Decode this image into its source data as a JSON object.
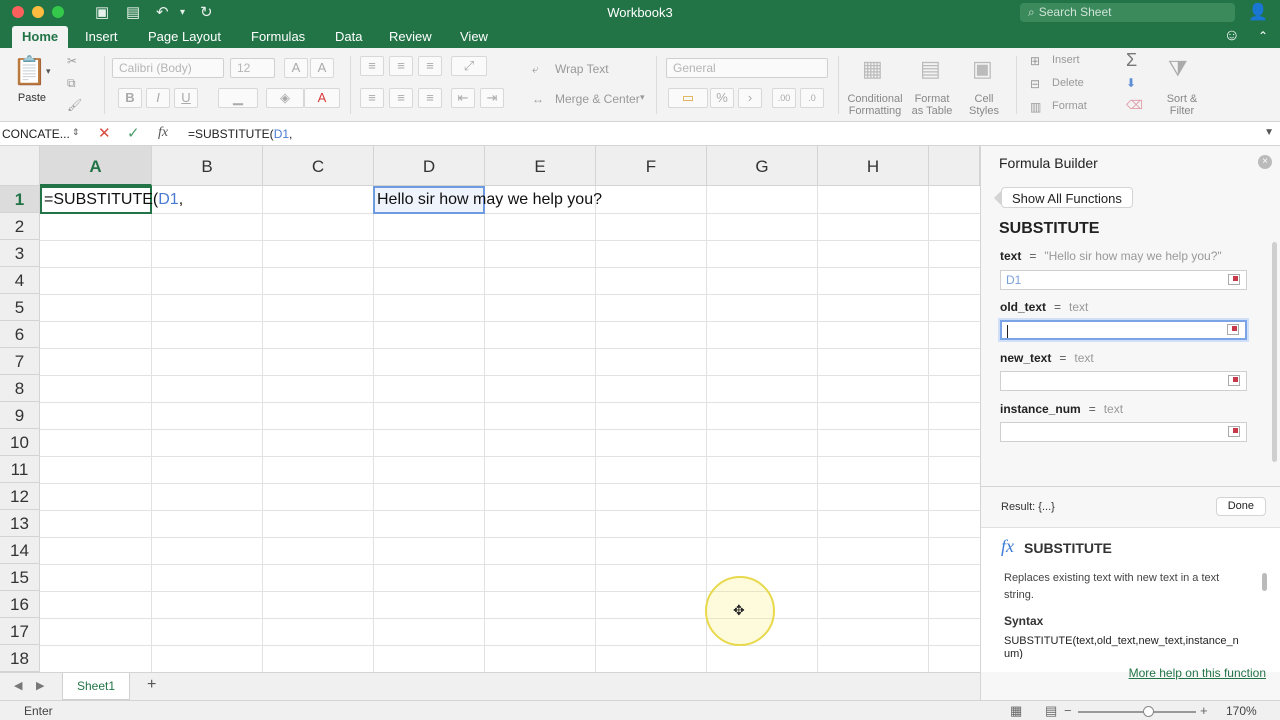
{
  "window": {
    "title": "Workbook3"
  },
  "search": {
    "placeholder": "Search Sheet"
  },
  "tabs": [
    {
      "label": "Home"
    },
    {
      "label": "Insert"
    },
    {
      "label": "Page Layout"
    },
    {
      "label": "Formulas"
    },
    {
      "label": "Data"
    },
    {
      "label": "Review"
    },
    {
      "label": "View"
    }
  ],
  "ribbon": {
    "paste": "Paste",
    "font_name": "Calibri (Body)",
    "font_size": "12",
    "bold": "B",
    "italic": "I",
    "underline": "U",
    "wrap_text": "Wrap Text",
    "merge_center": "Merge & Center",
    "number_format": "General",
    "percent": "%",
    "conditional_formatting": "Conditional Formatting",
    "format_as_table": "Format as Table",
    "cell_styles": "Cell Styles",
    "insert": "Insert",
    "delete": "Delete",
    "format": "Format",
    "sort_filter": "Sort & Filter"
  },
  "formula_bar": {
    "name_box": "CONCATE...",
    "prefix": "=SUBSTITUTE(",
    "ref": "D1",
    "suffix": ","
  },
  "columns": [
    "A",
    "B",
    "C",
    "D",
    "E",
    "F",
    "G",
    "H"
  ],
  "rows": [
    "1",
    "2",
    "3",
    "4",
    "5",
    "6",
    "7",
    "8",
    "9",
    "10",
    "11",
    "12",
    "13",
    "14",
    "15",
    "16",
    "17",
    "18"
  ],
  "cells": {
    "a1_prefix": "=SUBSTITUTE(",
    "a1_ref": "D1",
    "a1_suffix": ",",
    "d1": "Hello sir how may we help you?"
  },
  "sheets": [
    {
      "label": "Sheet1"
    }
  ],
  "status": {
    "mode": "Enter",
    "zoom": "170%",
    "zoom_fraction": 0.6
  },
  "formula_builder": {
    "title": "Formula Builder",
    "show_all": "Show All Functions",
    "function_name": "SUBSTITUTE",
    "args": [
      {
        "name": "text",
        "eq": "=",
        "hint": "\"Hello sir how may we help you?\"",
        "value": "D1"
      },
      {
        "name": "old_text",
        "eq": "=",
        "hint": "text",
        "value": ""
      },
      {
        "name": "new_text",
        "eq": "=",
        "hint": "text",
        "value": ""
      },
      {
        "name": "instance_num",
        "eq": "=",
        "hint": "text",
        "value": ""
      }
    ],
    "result": "Result: {...}",
    "done": "Done",
    "help_title": "SUBSTITUTE",
    "help_desc": "Replaces existing text with new text in a text string.",
    "syntax_label": "Syntax",
    "syntax_text": "SUBSTITUTE(text,old_text,new_text,instance_num)",
    "more_help": "More help on this function"
  }
}
